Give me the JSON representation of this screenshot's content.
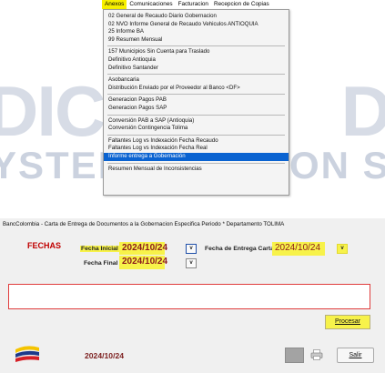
{
  "background": {
    "row1_left": "DIC",
    "row1_right": "D",
    "row2_left": "YSTEM",
    "row2_right": "ON S.A"
  },
  "menubar": {
    "items": [
      "Anexos",
      "Comunicaciones",
      "Facturacion",
      "Recepcion de Copias"
    ]
  },
  "dropdown": {
    "groups": [
      [
        "02 General de Recaudo Diario Gobernacion",
        "02 NVO Informe General de Recaudo Vehiculos ANTIOQUIA",
        "25  Informe BA",
        "99 Resumen Mensual"
      ],
      [
        "157 Municipios Sin Cuenta para Traslado",
        "Definitivo Antioquia",
        "Definitivo Santander"
      ],
      [
        "Asobancaria",
        "Distribución Enviado por el Proveedor  al  Banco <DF>"
      ],
      [
        "Generacion Pagos PAB",
        "Generacion Pagos SAP"
      ],
      [
        "Conversión PAB a SAP  (Antioquia)",
        "Conversión Contingencia Tolima"
      ],
      [
        "Faltantes Log vs Indexación Fecha Recaudo",
        "Faltantes Log vs Indexación Fecha Real",
        "Informe entrega a Gobernación"
      ],
      [
        "Resumen Mensual de Inconsistencias"
      ]
    ],
    "selected": "Informe entrega a Gobernación"
  },
  "dialog": {
    "title": "BancColombia - Carta de Entrega de Documentos a la Gobernacion Especifica Periodo * Departamento TOLIMA",
    "section_label": "FECHAS",
    "fecha_inicial_label": "Fecha Inicial",
    "fecha_inicial_value": "2024/10/24",
    "fecha_final_label": "Fecha Final",
    "fecha_final_value": "2024/10/24",
    "fecha_entrega_label": "Fecha de Entrega Carta",
    "fecha_entrega_value": "2024/10/24",
    "dropdown_btn": "v",
    "procesar_label": "Procesar",
    "salir_label": "Salir",
    "footer_date": "2024/10/24"
  },
  "colors": {
    "highlight_yellow": "#f7f24a",
    "menu_selected": "#0a63d1",
    "date_text": "#8b1a1a",
    "fechas_label": "#c00000",
    "message_border": "#e03c3c"
  },
  "icons": {
    "logo": "bancolombia-logo-icon",
    "printer": "printer-icon"
  }
}
